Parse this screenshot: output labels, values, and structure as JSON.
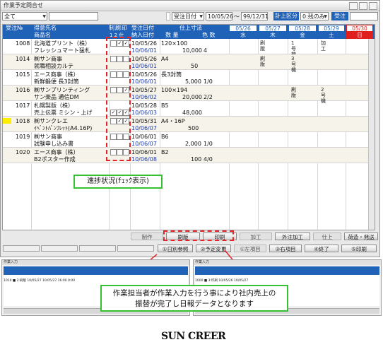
{
  "window": {
    "title": "作業予定問合せ"
  },
  "toolbar": {
    "filter_select": "全て",
    "date_type": "受注日付",
    "date_from": "10/05/26",
    "date_sep": "～",
    "date_to": "99/12/31",
    "calc_label": "計上区分",
    "calc_value": "0:残のみ",
    "order_label": "受注№"
  },
  "header": {
    "col_order_no": "受注№",
    "col_customer": "得意先名",
    "col_product": "商品名",
    "col_check": "制刷印",
    "col_check_nums": "1 2 仕",
    "col_order_date": "受注日付",
    "col_delivery_date": "納入日付",
    "col_spec": "仕上寸法",
    "col_qty": "数 量",
    "col_colors": "色 数",
    "days": [
      {
        "date": "05/26",
        "dow": "水"
      },
      {
        "date": "05/27",
        "dow": "木"
      },
      {
        "date": "05/28",
        "dow": "金"
      },
      {
        "date": "05/29",
        "dow": "土"
      },
      {
        "date": "05/30",
        "dow": "日"
      }
    ]
  },
  "rows": [
    {
      "no": "1008",
      "customer": "北海道プリント（株）",
      "product": "フレッシュマート猛札",
      "checks": [
        "",
        "✓",
        "✓"
      ],
      "order_date": "10/05/26",
      "delivery": "10/06/01",
      "spec": "120×100",
      "qty": "10,000",
      "colors": "4",
      "d1": "刷版",
      "d2": "1号機",
      "d3": "加工"
    },
    {
      "no": "1014",
      "customer": "㈱サン商事",
      "product": "就職相談カルテ",
      "checks": [
        "",
        "",
        ""
      ],
      "order_date": "10/05/26",
      "delivery": "10/06/01",
      "spec": "A4",
      "qty": "50",
      "colors": "",
      "d1": "刷版",
      "d2": "3号機",
      "d3": ""
    },
    {
      "no": "1015",
      "customer": "エース商事（株）",
      "product": "新鮮鍛便 長3封筒",
      "checks": [
        "",
        "",
        ""
      ],
      "order_date": "10/05/26",
      "delivery": "10/06/01",
      "spec": "長3封筒",
      "qty": "5,000",
      "colors": "1/0",
      "d1": "",
      "d2": "",
      "d3": ""
    },
    {
      "no": "1016",
      "customer": "㈱サンプリンティング",
      "product": "サン楽品 通信DM",
      "checks": [
        "",
        "",
        "✓"
      ],
      "order_date": "10/05/27",
      "delivery": "10/06/02",
      "spec": "100×194",
      "qty": "20,000",
      "colors": "2/2",
      "d1": "",
      "d2": "刷版",
      "d3": "2号機"
    },
    {
      "no": "1017",
      "customer": "札幌製版（株）",
      "product": "売上伝票 ミシン・上げ",
      "checks": [
        "✓",
        "✓",
        "✓"
      ],
      "order_date": "10/05/28",
      "delivery": "10/06/03",
      "spec": "B5",
      "qty": "48,000",
      "colors": "",
      "d1": "",
      "d2": "",
      "d3": ""
    },
    {
      "no": "1018",
      "customer": "㈱サンクレエ",
      "product": "ｲﾍﾞﾝﾄﾊﾟﾝﾌﾚｯﾄ(A4.16P)",
      "checks": [
        "",
        "✓",
        "✓"
      ],
      "order_date": "10/05/31",
      "delivery": "10/06/07",
      "spec": "A4・16P",
      "qty": "500",
      "colors": "",
      "d1": "",
      "d2": "",
      "d3": ""
    },
    {
      "no": "1019",
      "customer": "㈱サン商事",
      "product": "試験申し込み書",
      "checks": [
        "",
        "",
        ""
      ],
      "order_date": "10/06/01",
      "delivery": "10/06/07",
      "spec": "B6",
      "qty": "2,000",
      "colors": "1/0",
      "d1": "",
      "d2": "",
      "d3": ""
    },
    {
      "no": "1020",
      "customer": "エース商事（株）",
      "product": "B2ポスター作成",
      "checks": [
        "",
        "",
        ""
      ],
      "order_date": "10/06/01",
      "delivery": "10/06/08",
      "spec": "B2",
      "qty": "100",
      "colors": "4/0",
      "d1": "",
      "d2": "",
      "d3": ""
    }
  ],
  "annotation_progress": "進捗状況(ﾁｪｯｸ表示)",
  "function_bar": [
    "制作",
    "刷版",
    "印刷",
    "加工",
    "外注加工",
    "仕上",
    "荷造・発送"
  ],
  "bottom_buttons": [
    "①日別参照",
    "②予定変更",
    "①左項目",
    "③右項目",
    "④終了",
    "⑤印刷"
  ],
  "mini_left": {
    "title": "作業入力",
    "row": "1010 ■ 2:刷版 10/05/27 10/05/27 16:00 0:00"
  },
  "mini_right": {
    "title": "作業入力",
    "row": "1000 ■ 3:印刷 10/05/26 10/05/27"
  },
  "annotation_bottom": [
    "作業担当者が作業入力を行う事により社内売上の",
    "振替が完了し日報データとなります"
  ],
  "logo": "SUN CREER",
  "colors": {
    "header_blue": "#1f62b8",
    "highlight": "#e3242b",
    "frame_green": "#34c234",
    "sunday_red": "#e0201e"
  }
}
